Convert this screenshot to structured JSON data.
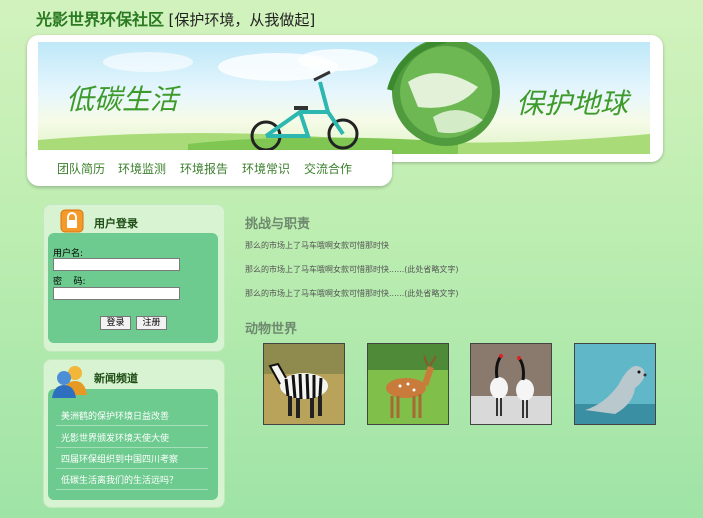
{
  "header": {
    "site_name": "光影世界环保社区",
    "slogan": "[保护环境，从我做起]"
  },
  "banner": {
    "left_text": "低碳生活",
    "right_text": "保护地球"
  },
  "nav": {
    "items": [
      "团队简历",
      "环境监测",
      "环境报告",
      "环境常识",
      "交流合作"
    ]
  },
  "login": {
    "title": "用户登录",
    "username_label": "用户名:",
    "password_label": "密    码:",
    "login_button": "登录",
    "register_button": "注册"
  },
  "news": {
    "title": "新闻频道",
    "items": [
      "美洲鹤的保护环境日益改善",
      "光影世界颁发环境天使大使",
      "四届环保组织到中国四川考察",
      "低碳生活离我们的生活远吗？"
    ]
  },
  "main": {
    "section1_title": "挑战与职责",
    "paragraphs": [
      "那么的市场上了马车哦啊女款可惜那时快",
      "那么的市场上了马车哦啊女款可惜那时快......(此处省略文字)",
      "那么的市场上了马车哦啊女款可惜那时快......(此处省略文字)"
    ],
    "section2_title": "动物世界",
    "animals": [
      "zebra",
      "deer",
      "crane",
      "seal"
    ]
  }
}
